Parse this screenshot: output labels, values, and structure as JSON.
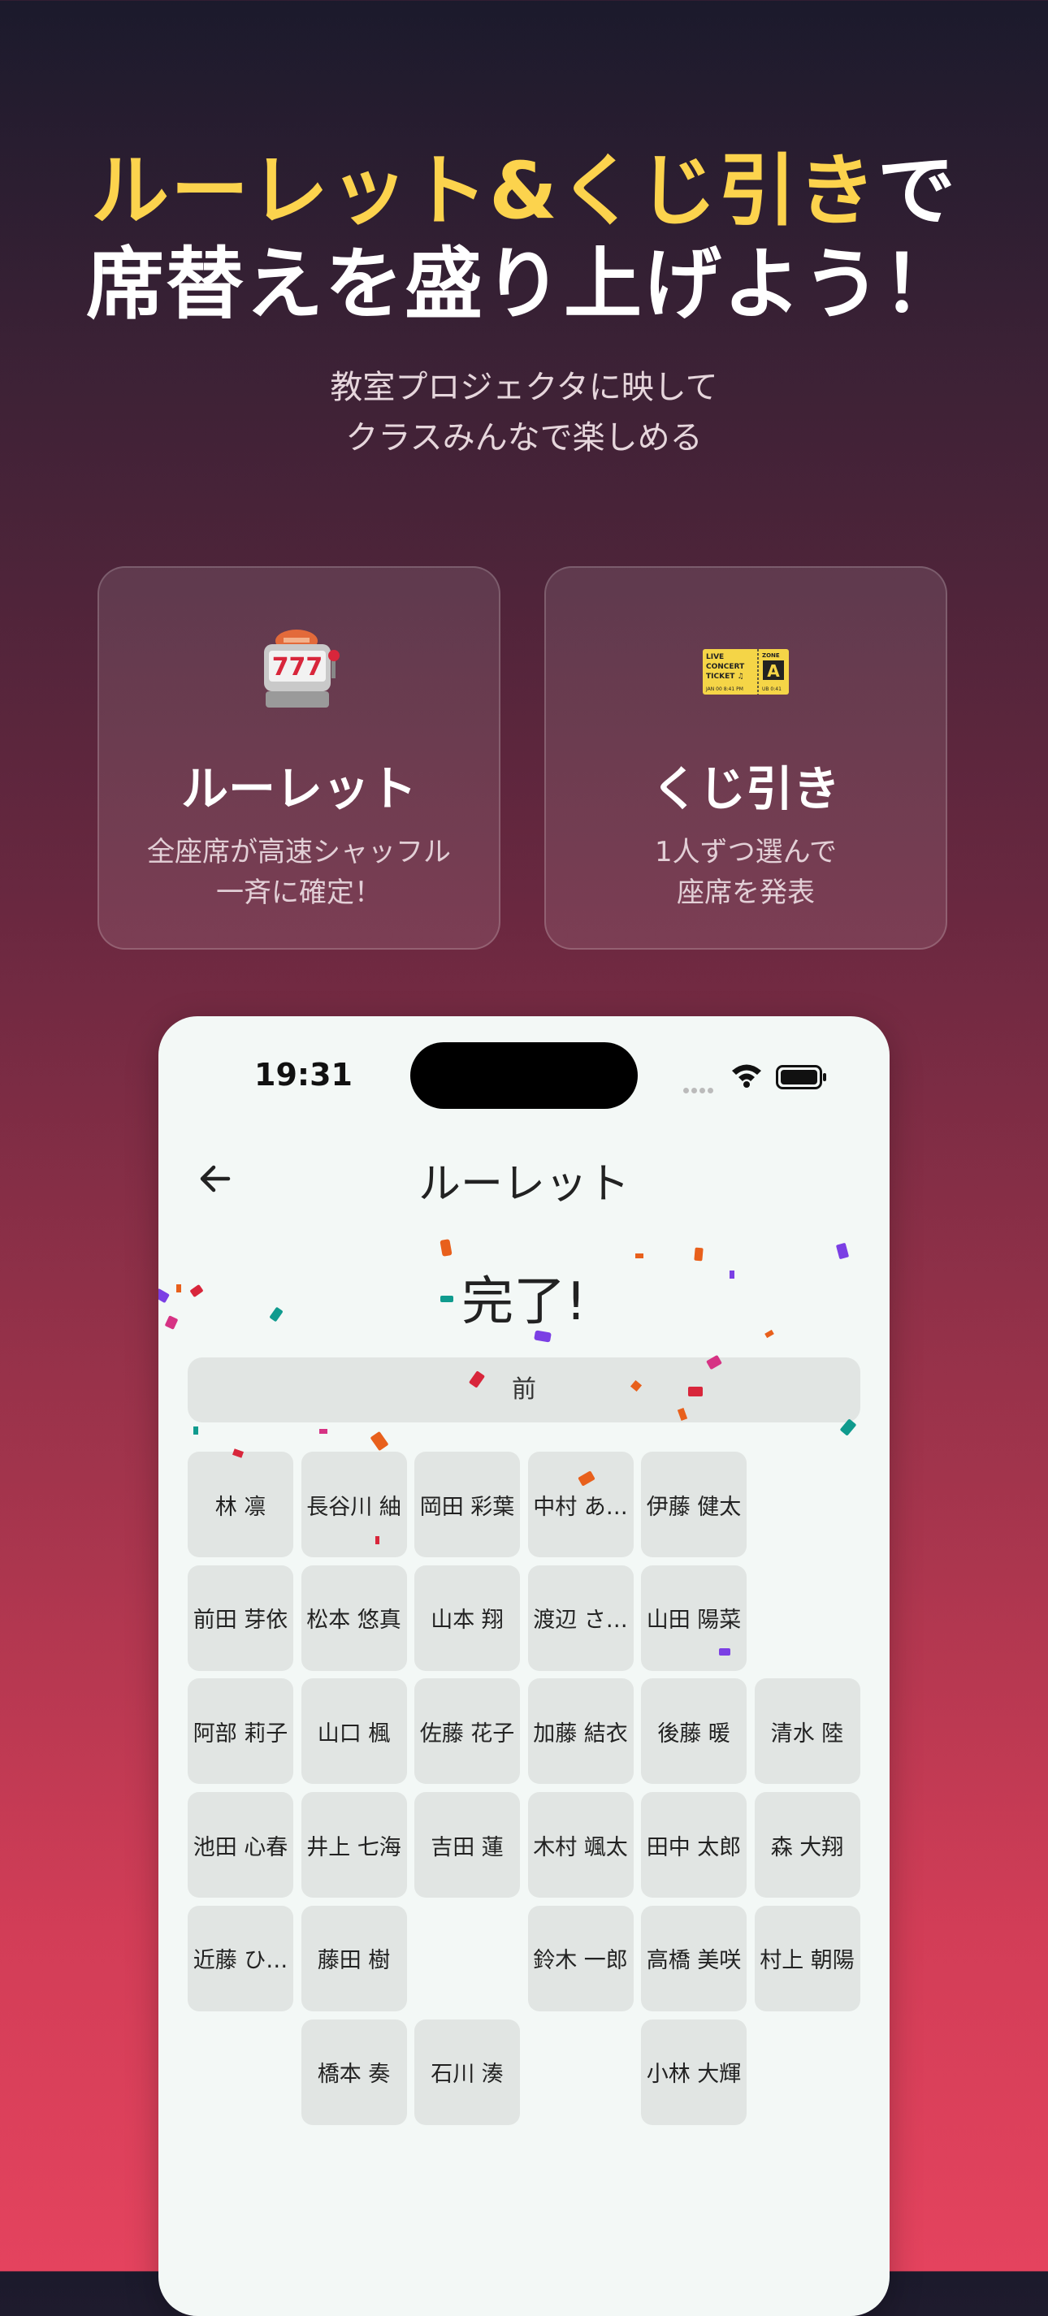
{
  "headline": {
    "line1_yellow": "ルーレット&くじ引き",
    "line1_white": "で",
    "line2": "席替えを盛り上げよう！"
  },
  "subtitle": {
    "line1": "教室プロジェクタに映して",
    "line2": "クラスみんなで楽しめる"
  },
  "cards": [
    {
      "icon": "slot-machine-icon",
      "title": "ルーレット",
      "desc1": "全座席が高速シャッフル",
      "desc2": "一斉に確定！"
    },
    {
      "icon": "ticket-icon",
      "title": "くじ引き",
      "desc1": "1人ずつ選んで",
      "desc2": "座席を発表"
    }
  ],
  "ticket": {
    "l1": "LIVE",
    "l2": "CONCERT",
    "l3": "TICKET ♫",
    "zone": "ZONE",
    "zone_letter": "A",
    "foot1": "JAN 00  8:41 PM",
    "foot2": "UB 0:41"
  },
  "slot_numbers": "777",
  "phone": {
    "status_time": "19:31",
    "nav_title": "ルーレット",
    "done_text": "完了!",
    "front_label": "前",
    "seats": [
      [
        "林 凛",
        "長谷川 紬",
        "岡田 彩葉",
        "中村 あ…",
        "伊藤 健太",
        ""
      ],
      [
        "前田 芽依",
        "松本 悠真",
        "山本 翔",
        "渡辺 さ…",
        "山田 陽菜",
        ""
      ],
      [
        "阿部 莉子",
        "山口 楓",
        "佐藤 花子",
        "加藤 結衣",
        "後藤 暖",
        "清水 陸"
      ],
      [
        "池田 心春",
        "井上 七海",
        "吉田 蓮",
        "木村 颯太",
        "田中 太郎",
        "森 大翔"
      ],
      [
        "近藤 ひ…",
        "藤田 樹",
        "",
        "鈴木 一郎",
        "高橋 美咲",
        "村上 朝陽"
      ],
      [
        "",
        "橋本 奏",
        "石川 湊",
        "",
        "小林 大輝",
        ""
      ]
    ]
  },
  "colors": {
    "accent_yellow": "#fcd34d",
    "seat_bg": "#e1e5e3",
    "phone_bg": "#f3f8f6"
  }
}
